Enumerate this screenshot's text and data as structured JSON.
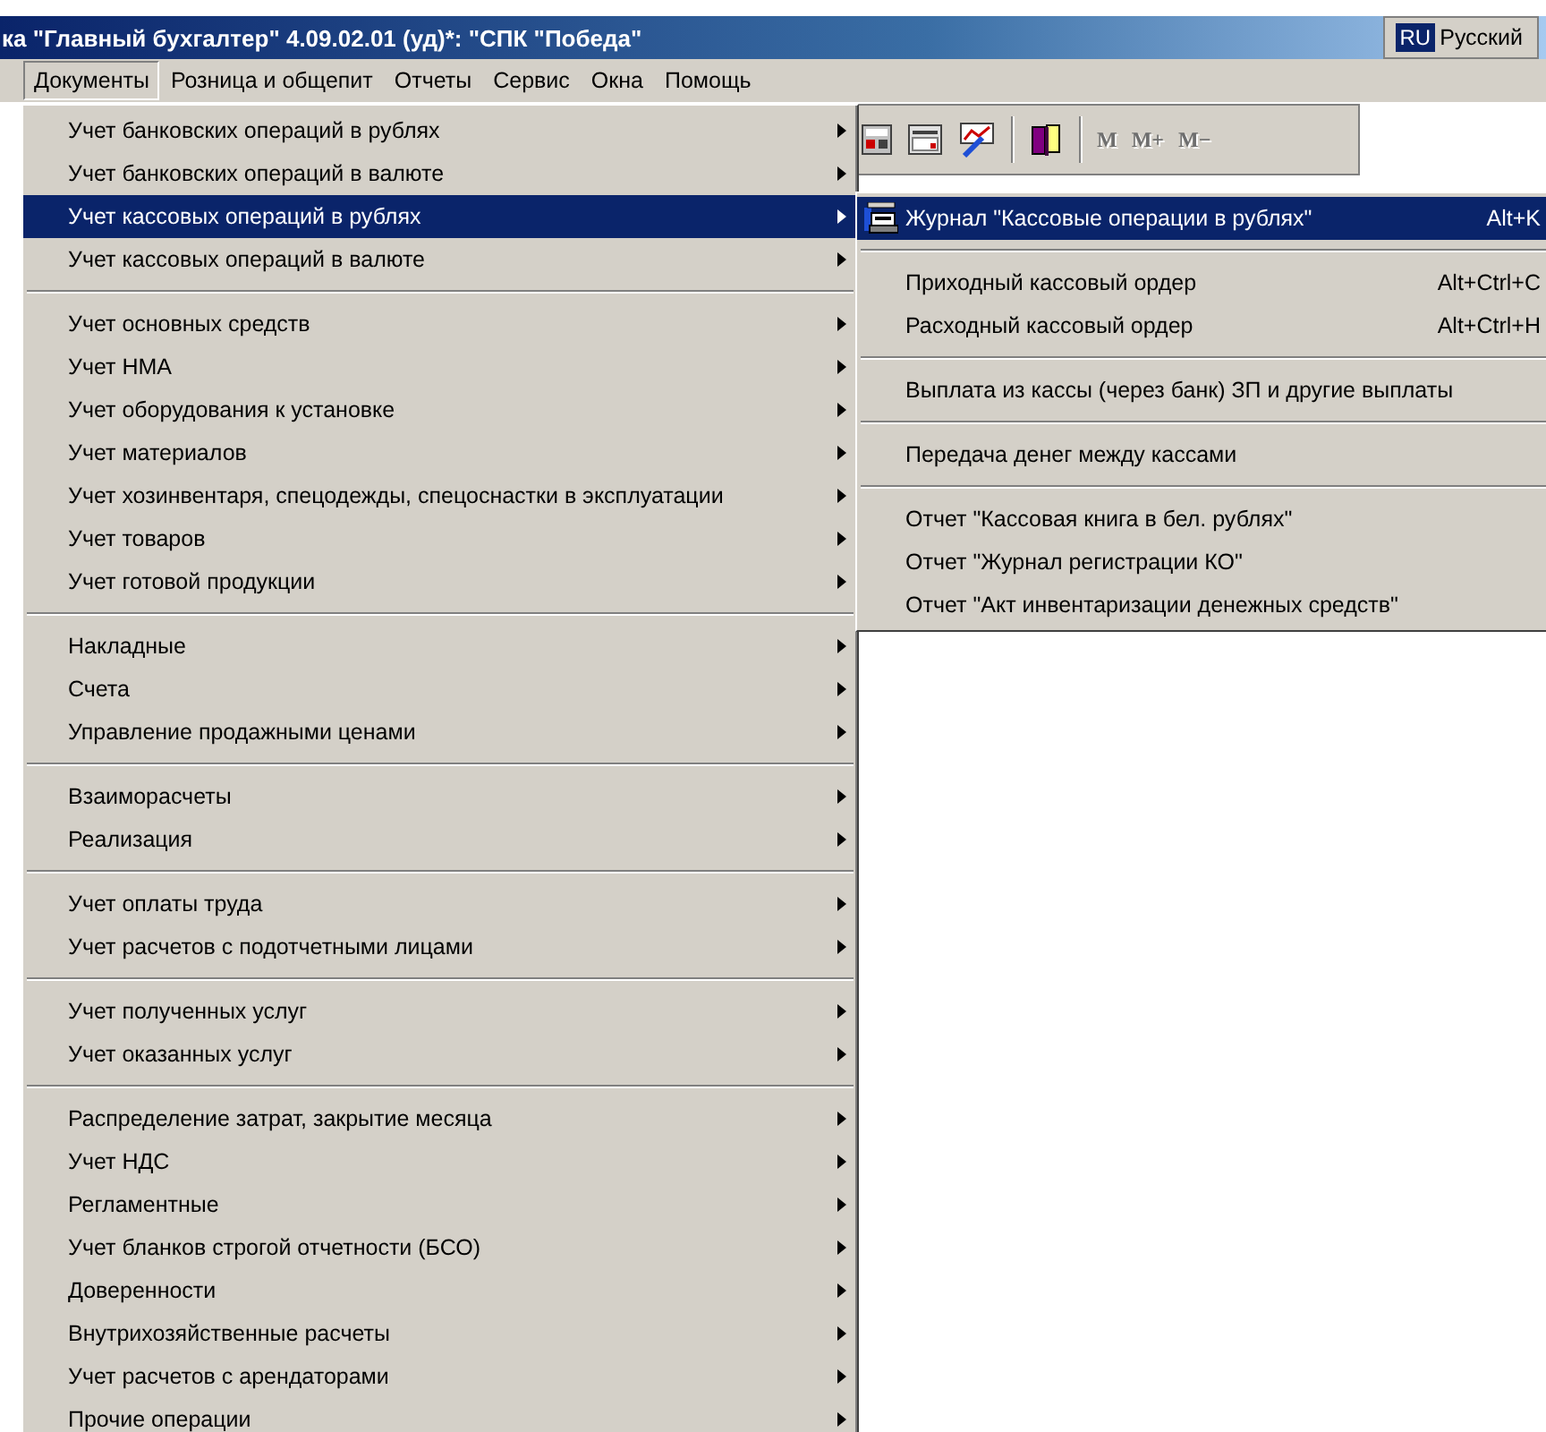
{
  "window": {
    "title": "ка \"Главный бухгалтер\" 4.09.02.01 (уд)*: \"СПК \"Победа\""
  },
  "language_bar": {
    "code": "RU",
    "label": "Русский"
  },
  "menu_bar": [
    {
      "label": "Документы",
      "selected": true
    },
    {
      "label": "Розница и общепит",
      "selected": false
    },
    {
      "label": "Отчеты",
      "selected": false
    },
    {
      "label": "Сервис",
      "selected": false
    },
    {
      "label": "Окна",
      "selected": false
    },
    {
      "label": "Помощь",
      "selected": false
    }
  ],
  "toolbar": {
    "memory_buttons": [
      {
        "label": "M",
        "disabled": true
      },
      {
        "label": "M+",
        "disabled": true
      },
      {
        "label": "M−",
        "disabled": true
      }
    ]
  },
  "menu": {
    "groups": [
      [
        {
          "label": "Учет банковских операций в рублях",
          "selected": false
        },
        {
          "label": "Учет банковских операций в валюте",
          "selected": false
        },
        {
          "label": "Учет кассовых операций в рублях",
          "selected": true
        },
        {
          "label": "Учет кассовых операций в валюте",
          "selected": false
        }
      ],
      [
        {
          "label": "Учет основных средств",
          "selected": false
        },
        {
          "label": "Учет НМА",
          "selected": false
        },
        {
          "label": "Учет оборудования к установке",
          "selected": false
        },
        {
          "label": "Учет материалов",
          "selected": false
        },
        {
          "label": "Учет хозинвентаря, спецодежды, спецоснастки в эксплуатации",
          "selected": false
        },
        {
          "label": "Учет товаров",
          "selected": false
        },
        {
          "label": "Учет готовой продукции",
          "selected": false
        }
      ],
      [
        {
          "label": "Накладные",
          "selected": false
        },
        {
          "label": "Счета",
          "selected": false
        },
        {
          "label": "Управление продажными ценами",
          "selected": false
        }
      ],
      [
        {
          "label": "Взаиморасчеты",
          "selected": false
        },
        {
          "label": "Реализация",
          "selected": false
        }
      ],
      [
        {
          "label": "Учет оплаты труда",
          "selected": false
        },
        {
          "label": "Учет расчетов с подотчетными лицами",
          "selected": false
        }
      ],
      [
        {
          "label": "Учет полученных услуг",
          "selected": false
        },
        {
          "label": "Учет оказанных услуг",
          "selected": false
        }
      ],
      [
        {
          "label": "Распределение затрат, закрытие месяца",
          "selected": false
        },
        {
          "label": "Учет НДС",
          "selected": false
        },
        {
          "label": "Регламентные",
          "selected": false
        },
        {
          "label": "Учет бланков строгой отчетности (БСО)",
          "selected": false
        },
        {
          "label": "Доверенности",
          "selected": false
        },
        {
          "label": "Внутрихозяйственные расчеты",
          "selected": false
        },
        {
          "label": "Учет расчетов с арендаторами",
          "selected": false
        },
        {
          "label": "Прочие операции",
          "selected": false
        }
      ]
    ]
  },
  "submenu": {
    "groups": [
      [
        {
          "label": "Журнал \"Кассовые операции в рублях\"",
          "shortcut": "Alt+K",
          "selected": true,
          "icon": true
        }
      ],
      [
        {
          "label": "Приходный кассовый ордер",
          "shortcut": "Alt+Ctrl+C",
          "selected": false,
          "icon": false
        },
        {
          "label": "Расходный кассовый ордер",
          "shortcut": "Alt+Ctrl+H",
          "selected": false,
          "icon": false
        }
      ],
      [
        {
          "label": "Выплата из кассы (через банк)  ЗП и другие выплаты",
          "selected": false,
          "icon": false
        }
      ],
      [
        {
          "label": "Передача денег между кассами",
          "selected": false,
          "icon": false
        }
      ],
      [
        {
          "label": "Отчет \"Кассовая книга в бел. рублях\"",
          "selected": false,
          "icon": false
        },
        {
          "label": "Отчет \"Журнал регистрации КО\"",
          "selected": false,
          "icon": false
        },
        {
          "label": "Отчет \"Акт инвентаризации денежных средств\"",
          "selected": false,
          "icon": false
        }
      ]
    ]
  }
}
